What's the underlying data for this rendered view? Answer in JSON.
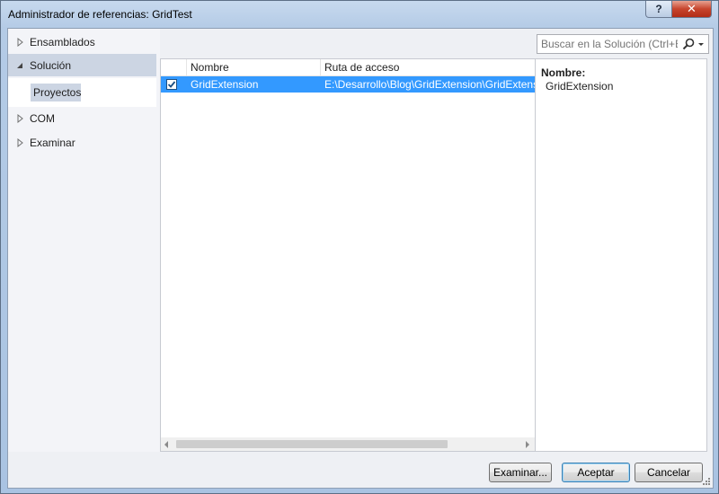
{
  "window": {
    "title": "Administrador de referencias: GridTest",
    "help_label": "?",
    "close_label": "✕"
  },
  "nav": {
    "items": [
      {
        "label": "Ensamblados",
        "expanded": false,
        "selected": false
      },
      {
        "label": "Solución",
        "expanded": true,
        "selected": true
      },
      {
        "label": "COM",
        "expanded": false,
        "selected": false
      },
      {
        "label": "Examinar",
        "expanded": false,
        "selected": false
      }
    ],
    "sub_item": "Proyectos"
  },
  "search": {
    "placeholder": "Buscar en la Solución (Ctrl+E",
    "icon": "magnifier-icon"
  },
  "grid": {
    "columns": [
      "Nombre",
      "Ruta de acceso"
    ],
    "rows": [
      {
        "checked": true,
        "name": "GridExtension",
        "path": "E:\\Desarrollo\\Blog\\GridExtension\\GridExtension"
      }
    ]
  },
  "details": {
    "label": "Nombre:",
    "value": "GridExtension"
  },
  "buttons": {
    "browse": "Examinar...",
    "ok": "Aceptar",
    "cancel": "Cancelar"
  },
  "colors": {
    "selection": "#3399ff",
    "nav_selected": "#ccd5e3"
  }
}
